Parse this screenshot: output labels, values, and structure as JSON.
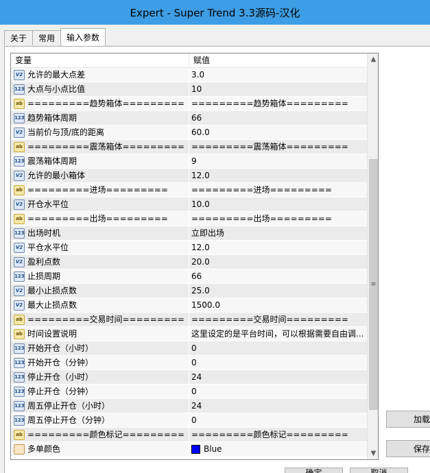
{
  "window": {
    "title": "Expert - Super Trend 3.3源码-汉化"
  },
  "tabs": [
    {
      "label": "关于"
    },
    {
      "label": "常用"
    },
    {
      "label": "输入参数"
    }
  ],
  "grid": {
    "headers": {
      "variable": "变量",
      "value": "赋值"
    },
    "rows": [
      {
        "icon": "v",
        "name": "允许的最大点差",
        "value": "3.0"
      },
      {
        "icon": "n",
        "name": "大点与小点比值",
        "value": "10"
      },
      {
        "icon": "ab",
        "name": "=========趋势箱体=========",
        "value": "=========趋势箱体========="
      },
      {
        "icon": "n",
        "name": "趋势箱体周期",
        "value": "66"
      },
      {
        "icon": "v",
        "name": "当前价与顶/底的距离",
        "value": "60.0"
      },
      {
        "icon": "ab",
        "name": "=========震荡箱体=========",
        "value": "=========震荡箱体========="
      },
      {
        "icon": "n",
        "name": "震荡箱体周期",
        "value": "9"
      },
      {
        "icon": "v",
        "name": "允许的最小箱体",
        "value": "12.0"
      },
      {
        "icon": "ab",
        "name": "=========进场=========",
        "value": "=========进场========="
      },
      {
        "icon": "v",
        "name": "开仓水平位",
        "value": "10.0"
      },
      {
        "icon": "ab",
        "name": "=========出场=========",
        "value": "=========出场========="
      },
      {
        "icon": "n",
        "name": "出场时机",
        "value": "立即出场"
      },
      {
        "icon": "v",
        "name": "平仓水平位",
        "value": "12.0"
      },
      {
        "icon": "v",
        "name": "盈利点数",
        "value": "20.0"
      },
      {
        "icon": "n",
        "name": "止损周期",
        "value": "66"
      },
      {
        "icon": "v",
        "name": "最小止损点数",
        "value": "25.0"
      },
      {
        "icon": "v",
        "name": "最大止损点数",
        "value": "1500.0"
      },
      {
        "icon": "ab",
        "name": "=========交易时间=========",
        "value": "=========交易时间========="
      },
      {
        "icon": "ab",
        "name": "时间设置说明",
        "value": "这里设定的是平台时间，可以根据需要自由调..."
      },
      {
        "icon": "n",
        "name": "开始开仓（小时）",
        "value": "0"
      },
      {
        "icon": "n",
        "name": "开始开仓（分钟）",
        "value": "0"
      },
      {
        "icon": "n",
        "name": "停止开仓（小时）",
        "value": "24"
      },
      {
        "icon": "n",
        "name": "停止开仓（分钟）",
        "value": "0"
      },
      {
        "icon": "n",
        "name": "周五停止开仓（小时）",
        "value": "24"
      },
      {
        "icon": "n",
        "name": "周五停止开仓（分钟）",
        "value": "0"
      },
      {
        "icon": "ab",
        "name": "=========颜色标记=========",
        "value": "=========颜色标记========="
      },
      {
        "icon": "c",
        "name": "多单颜色",
        "value": "Blue",
        "swatch": "#0000ff"
      }
    ]
  },
  "icon_glyphs": {
    "v": "V2",
    "n": "123",
    "ab": "ab",
    "c": ""
  },
  "side_buttons": {
    "load": "加载",
    "save": "保存"
  },
  "bottom_buttons": {
    "ok": "确定",
    "cancel": "取消"
  },
  "colors": {
    "title_bar": "#3e9ee5",
    "swatch_blue": "#0000ff"
  }
}
